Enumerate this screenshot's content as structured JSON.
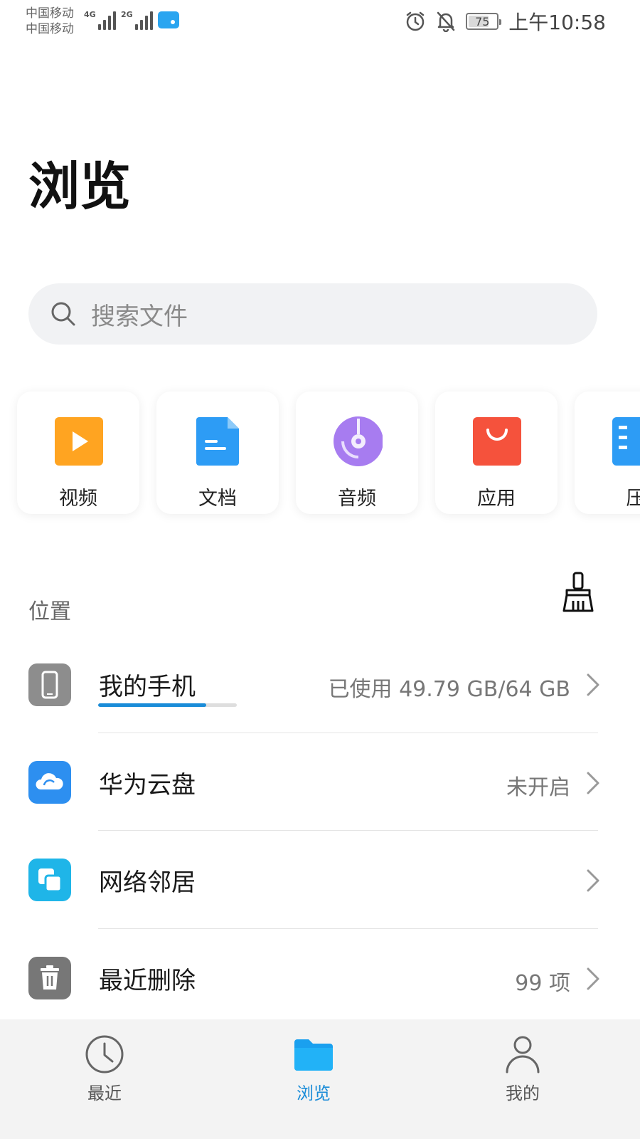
{
  "status_bar": {
    "carrier_1": "中国移动",
    "carrier_2": "中国移动",
    "network_1": "4G",
    "network_2": "2G",
    "battery": "75",
    "battery_level_percent": 75,
    "time": "上午10:58",
    "icons": [
      "signal-icon",
      "message-icon",
      "alarm-icon",
      "mute-bell-icon",
      "battery-icon"
    ]
  },
  "page_title": "浏览",
  "search": {
    "placeholder": "搜索文件",
    "icon": "search-icon"
  },
  "categories": [
    {
      "label": "视频",
      "icon": "video-icon",
      "color": "#ffa421"
    },
    {
      "label": "文档",
      "icon": "document-icon",
      "color": "#2d9cf5"
    },
    {
      "label": "音频",
      "icon": "audio-icon",
      "color": "#a77cf0"
    },
    {
      "label": "应用",
      "icon": "app-bag-icon",
      "color": "#f5523c"
    },
    {
      "label": "压",
      "icon": "archive-icon",
      "color": "#2d9cf5"
    }
  ],
  "location": {
    "title": "位置",
    "clean_icon": "broom-icon",
    "items": [
      {
        "label": "我的手机",
        "value": "已使用 49.79 GB/64 GB",
        "icon": "phone-icon",
        "color": "#8d8d8d",
        "storage_used_fraction": 0.78
      },
      {
        "label": "华为云盘",
        "value": "未开启",
        "icon": "cloud-icon",
        "color": "#2d8ff0"
      },
      {
        "label": "网络邻居",
        "value": "",
        "icon": "network-icon",
        "color": "#1fb5e8"
      },
      {
        "label": "最近删除",
        "value": "99 项",
        "icon": "trash-icon",
        "color": "#777777"
      }
    ]
  },
  "bottom_nav": {
    "items": [
      {
        "label": "最近",
        "icon": "clock-icon",
        "active": false
      },
      {
        "label": "浏览",
        "icon": "folder-icon",
        "active": true
      },
      {
        "label": "我的",
        "icon": "person-icon",
        "active": false
      }
    ],
    "active_color": "#1a8cd8"
  }
}
